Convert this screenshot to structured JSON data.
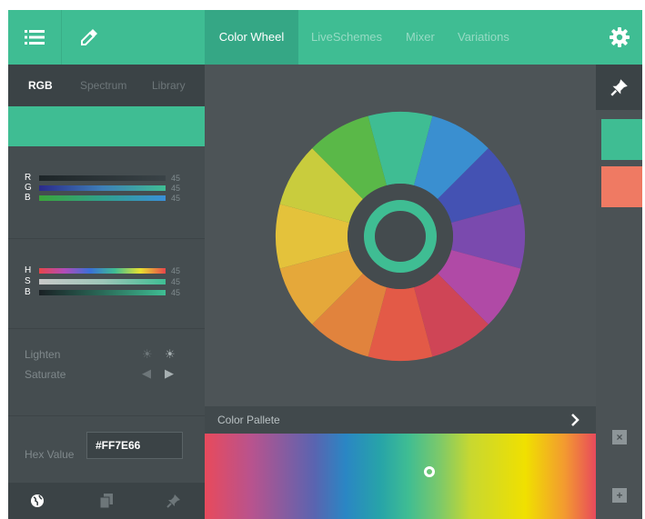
{
  "colors": {
    "accent": "#3fbd93",
    "accent_dark": "#35a785",
    "swatch_primary": "#3fbd93",
    "swatch_secondary": "#ef7a63"
  },
  "toolbar": {
    "menu_icon": "menu-icon",
    "picker_icon": "eyedropper-icon",
    "settings_icon": "gear-icon",
    "tabs": [
      {
        "label": "Color Wheel",
        "active": true
      },
      {
        "label": "LiveSchemes",
        "active": false
      },
      {
        "label": "Mixer",
        "active": false
      },
      {
        "label": "Variations",
        "active": false
      }
    ]
  },
  "left_panel": {
    "subtabs": [
      {
        "label": "RGB",
        "active": true
      },
      {
        "label": "Spectrum",
        "active": false
      },
      {
        "label": "Library",
        "active": false
      }
    ],
    "rgb": [
      {
        "label": "R",
        "value": "45"
      },
      {
        "label": "G",
        "value": "45"
      },
      {
        "label": "B",
        "value": "45"
      }
    ],
    "hsb": [
      {
        "label": "H",
        "value": "45"
      },
      {
        "label": "S",
        "value": "45"
      },
      {
        "label": "B",
        "value": "45"
      }
    ],
    "lighten_label": "Lighten",
    "saturate_label": "Saturate",
    "hex_label": "Hex Value",
    "hex_value": "#FF7E66",
    "bottom_icons": [
      "globe-icon",
      "copy-icon",
      "pin-icon"
    ]
  },
  "palette": {
    "title": "Color Pallete",
    "arrow_icon": "chevron-right-icon"
  },
  "right_panel": {
    "pin_icon": "pin-icon",
    "close_icon": "close-icon",
    "add_icon": "add-to-folder-icon"
  }
}
